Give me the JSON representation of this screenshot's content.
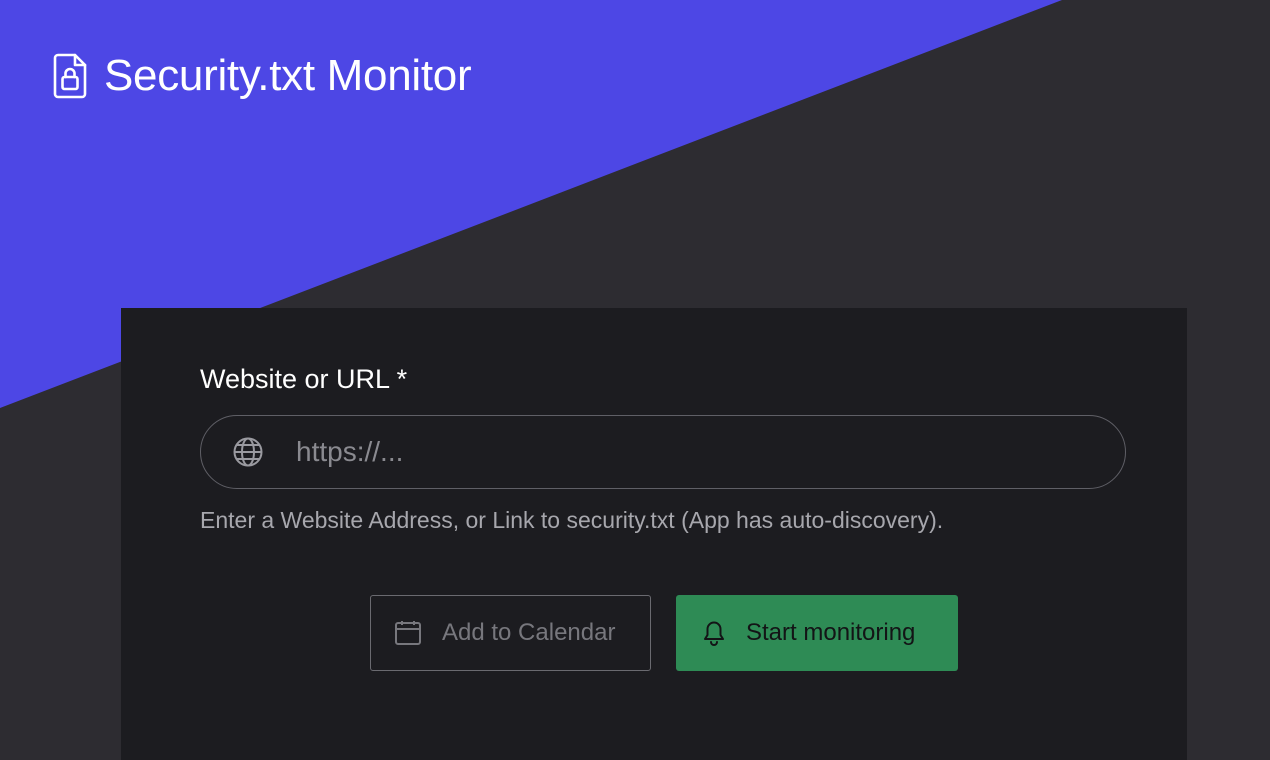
{
  "brand": {
    "title": "Security.txt Monitor",
    "icon": "file-lock-icon"
  },
  "form": {
    "url_field": {
      "label": "Website or URL *",
      "placeholder": "https://...",
      "value": "",
      "icon": "globe-icon"
    },
    "help_text": "Enter a Website Address, or Link to security.txt (App has auto-discovery)."
  },
  "actions": {
    "add_to_calendar": {
      "label": "Add to Calendar",
      "icon": "calendar-icon"
    },
    "start_monitoring": {
      "label": "Start monitoring",
      "icon": "bell-icon"
    }
  },
  "colors": {
    "accent": "#4d47e5",
    "background": "#2d2c31",
    "card": "#1c1c20",
    "success": "#2e8b55"
  }
}
